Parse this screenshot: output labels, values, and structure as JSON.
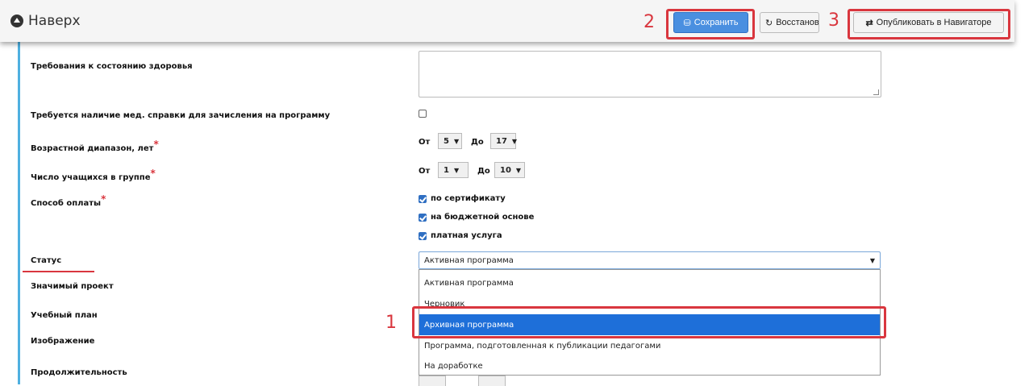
{
  "header": {
    "back_label": "Наверх",
    "save_label": "Сохранить",
    "restore_label": "Восстановить",
    "publish_label": "Опубликовать в Навигаторе"
  },
  "annotations": {
    "n1": "1",
    "n2": "2",
    "n3": "3"
  },
  "form": {
    "health_label": "Требования к состоянию здоровья",
    "med_label": "Требуется наличие мед. справки для зачисления на программу",
    "age_label": "Возрастной диапазон, лет",
    "group_label": "Число учащихся в группе",
    "payment_label": "Способ оплаты",
    "status_label": "Статус",
    "project_label": "Значимый проект",
    "plan_label": "Учебный план",
    "image_label": "Изображение",
    "duration_label": "Продолжительность",
    "required_mark": "*",
    "from": "От",
    "to": "До",
    "age_from": "5",
    "age_to": "17",
    "group_from": "1",
    "group_to": "10",
    "payment_options": [
      "по сертификату",
      "на бюджетной основе",
      "платная услуга"
    ],
    "status_value": "Активная программа",
    "status_options": [
      "Активная программа",
      "Черновик",
      "Архивная программа",
      "Программа, подготовленная к публикации педагогами",
      "На доработке"
    ]
  },
  "colors": {
    "accent": "#1e6fd9",
    "annotation": "#d9363e",
    "border_left": "#4fb0e0"
  }
}
